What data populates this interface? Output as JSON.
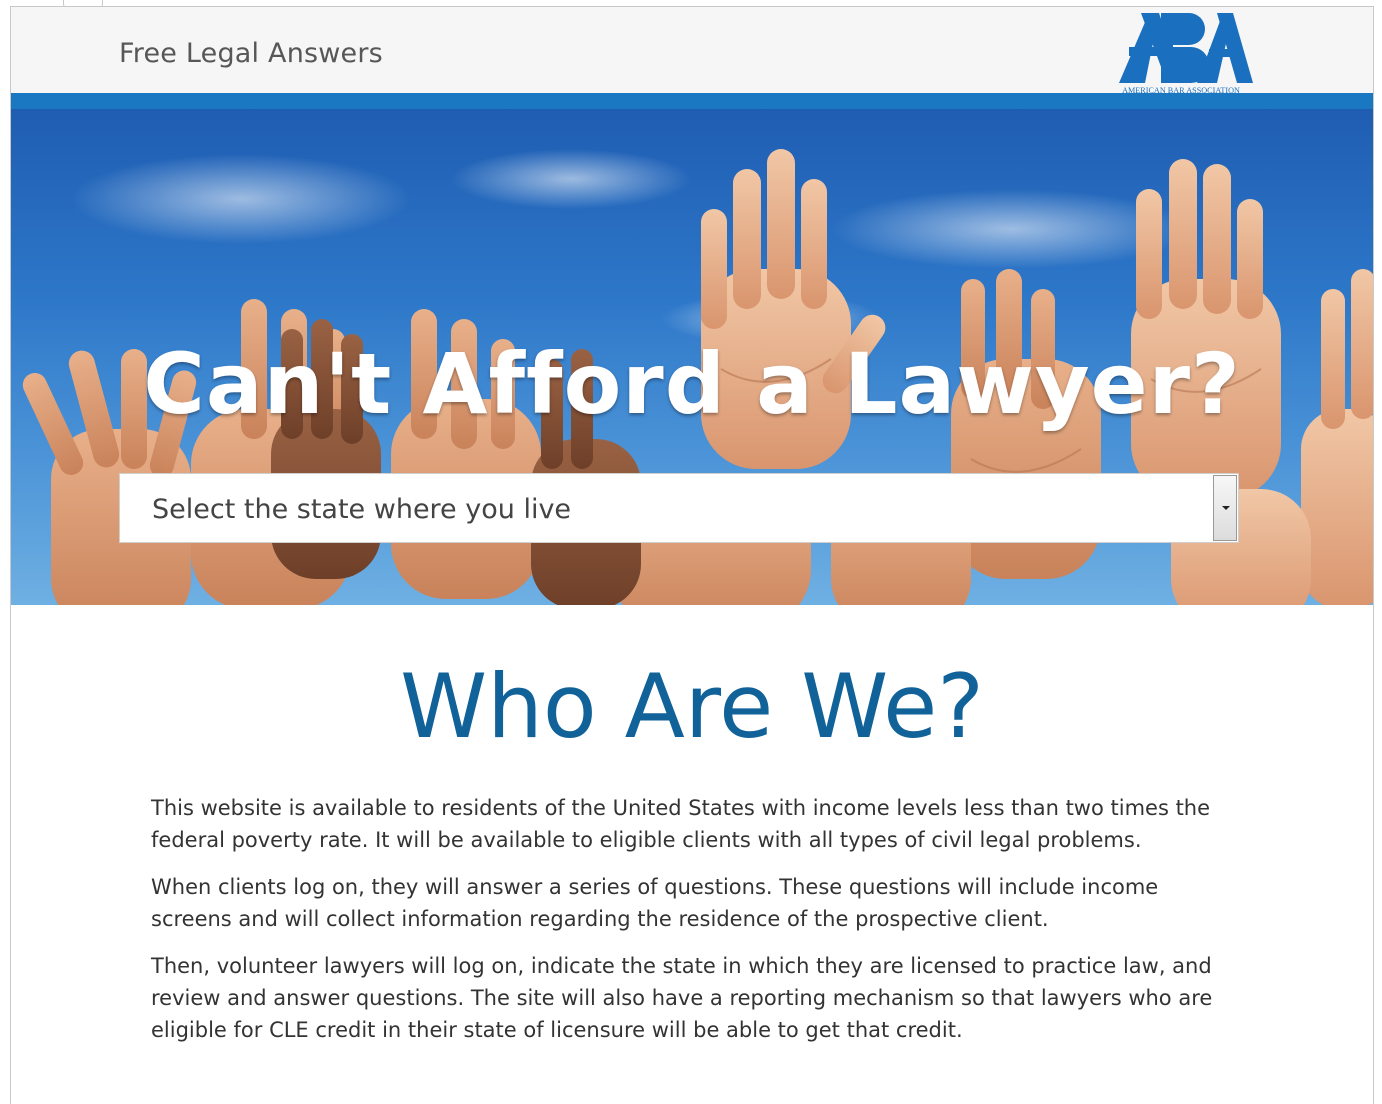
{
  "header": {
    "brand_title": "Free Legal Answers",
    "logo_letters": "ABA",
    "logo_caption": "AMERICAN BAR ASSOCIATION"
  },
  "hero": {
    "title": "Can't Afford a Lawyer?",
    "state_select": {
      "placeholder": "Select the state where you live"
    }
  },
  "about": {
    "heading": "Who Are We?",
    "paragraphs": [
      "This website is available to residents of the United States with income levels less than two times the federal poverty rate. It will be available to eligible clients with all types of civil legal problems.",
      "When clients log on, they will answer a series of questions. These questions will include income screens and will collect information regarding the residence of the prospective client.",
      "Then, volunteer lawyers will log on, indicate the state in which they are licensed to practice law, and review and answer questions. The site will also have a reporting mechanism so that lawyers who are eligible for CLE credit in their state of licensure will be able to get that credit."
    ]
  },
  "colors": {
    "brand_blue": "#1a78c2",
    "heading_blue": "#12629a",
    "sky_blue": "#2d77c9"
  },
  "icons": {
    "dropdown": "chevron-down-icon",
    "hero_image": "raised-hands-image"
  }
}
